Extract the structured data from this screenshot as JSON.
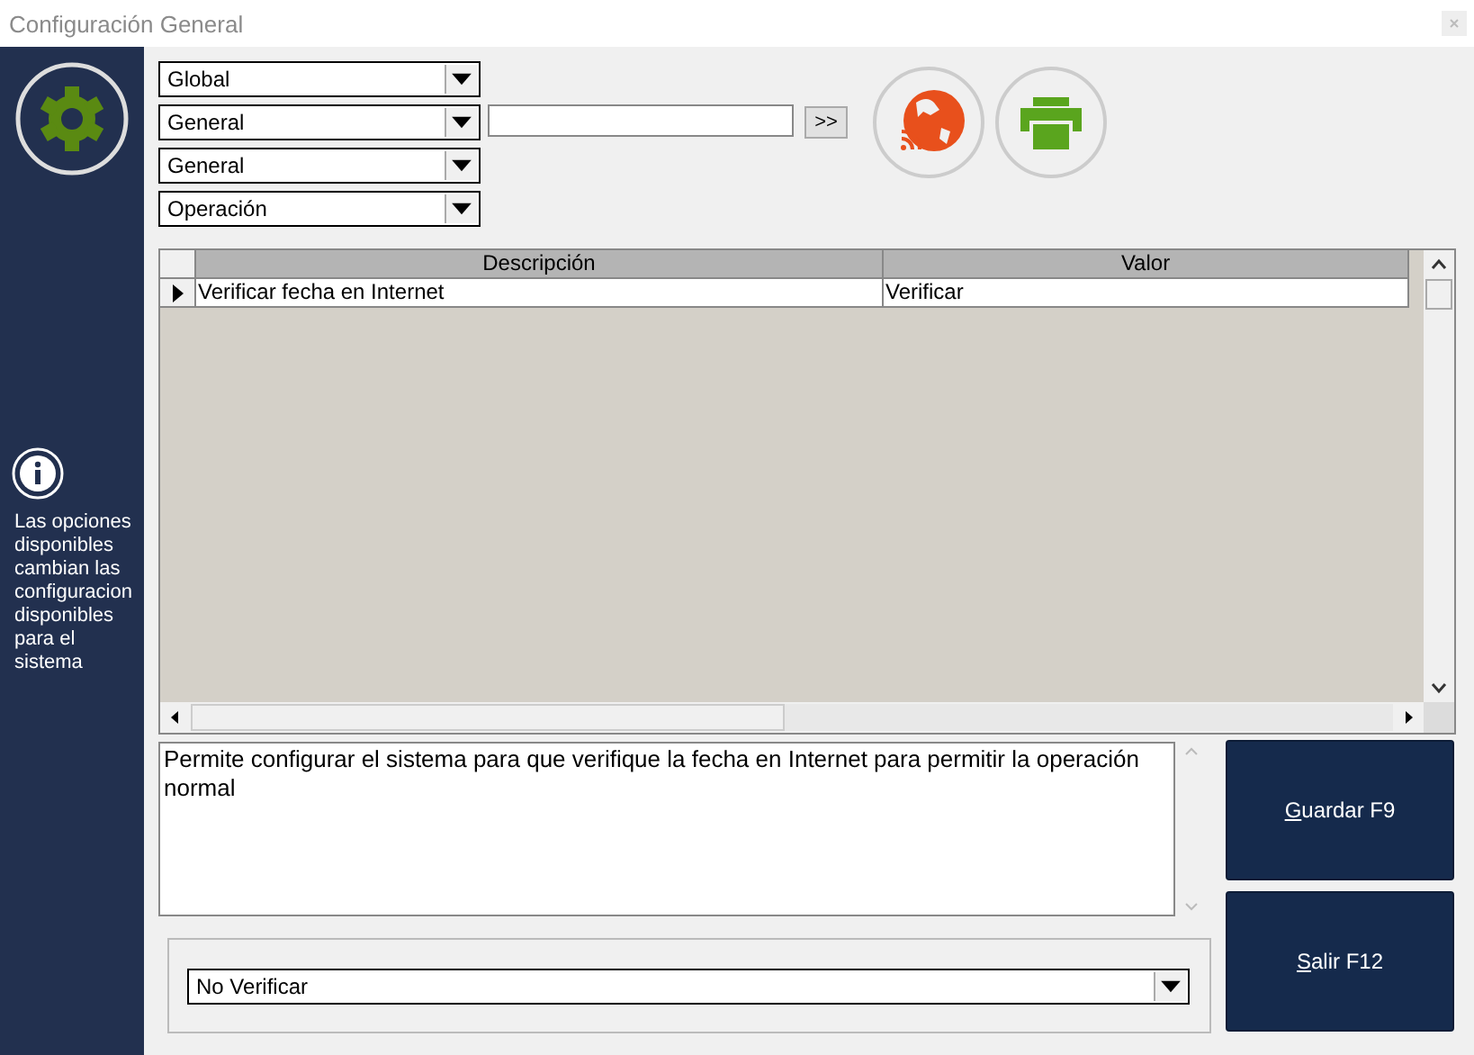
{
  "window": {
    "title": "Configuración General"
  },
  "sidebar": {
    "info_text": "Las opciones disponibles cambian las configuracion disponibles para el sistema"
  },
  "filters": [
    {
      "value": "Global"
    },
    {
      "value": "General"
    },
    {
      "value": "General"
    },
    {
      "value": "Operación"
    }
  ],
  "search": {
    "button": ">>"
  },
  "table": {
    "columns": [
      "Descripción",
      "Valor"
    ],
    "rows": [
      {
        "cells": [
          "Verificar fecha en Internet",
          "Verificar"
        ],
        "selected": true
      }
    ]
  },
  "description": "Permite configurar el sistema para que verifique la fecha en Internet para permitir la operación normal",
  "value_select": {
    "value": "No Verificar"
  },
  "buttons": [
    {
      "label": "Guardar F9"
    },
    {
      "label": "Salir F12"
    }
  ]
}
